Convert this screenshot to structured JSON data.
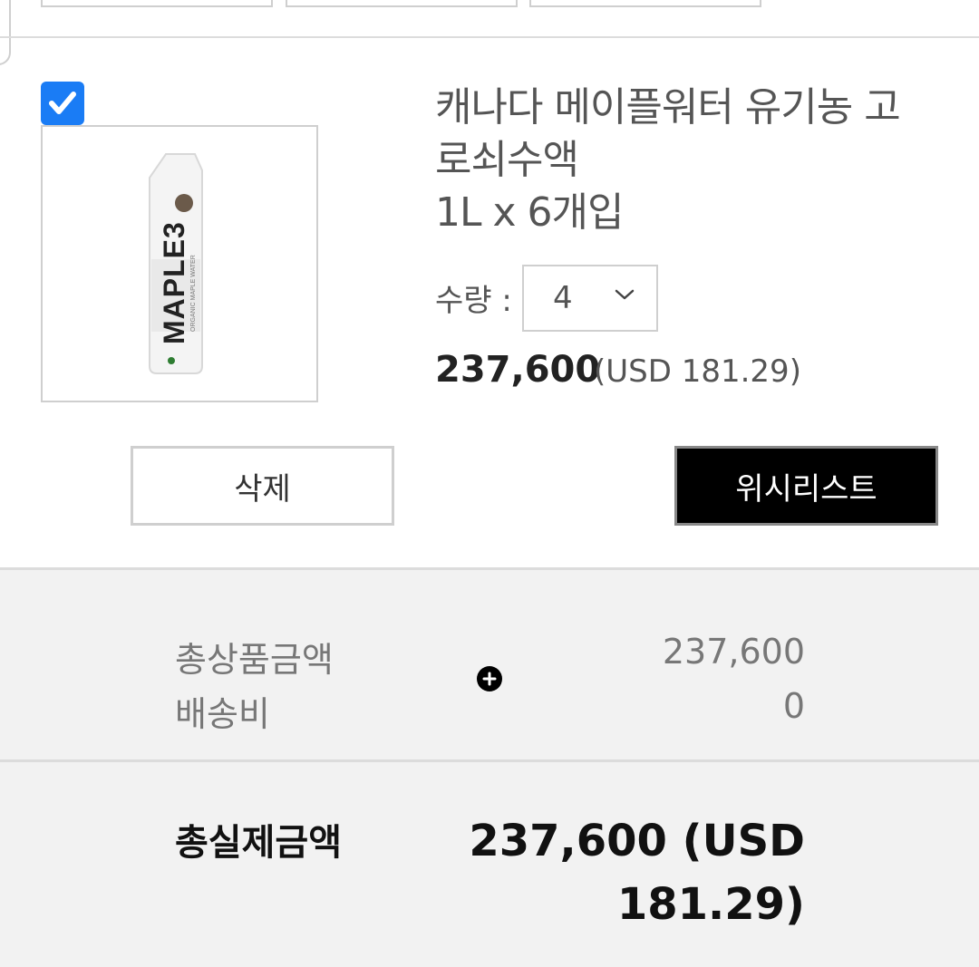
{
  "product": {
    "name_line1": "캐나다 메이플워터 유기농 고",
    "name_line2": "로쇠수액",
    "name_line3": "1L x 6개입",
    "image_brand": "MAPLE3",
    "quantity_label": "수량 :",
    "quantity_value": "4",
    "price": "237,600",
    "price_usd": "(USD 181.29)"
  },
  "actions": {
    "delete_label": "삭제",
    "wishlist_label": "위시리스트"
  },
  "summary": {
    "subtotal_label": "총상품금액",
    "subtotal_value": "237,600",
    "shipping_label": "배송비",
    "shipping_value": "0",
    "total_label": "총실제금액",
    "total_line1": "237,600 (USD",
    "total_line2": "181.29)"
  },
  "colors": {
    "checkbox": "#1a7cf5",
    "wishlist_bg": "#000000",
    "summary_bg": "#f2f2f2"
  },
  "icons": [
    "checkmark-icon",
    "chevron-down-icon",
    "plus-icon"
  ]
}
